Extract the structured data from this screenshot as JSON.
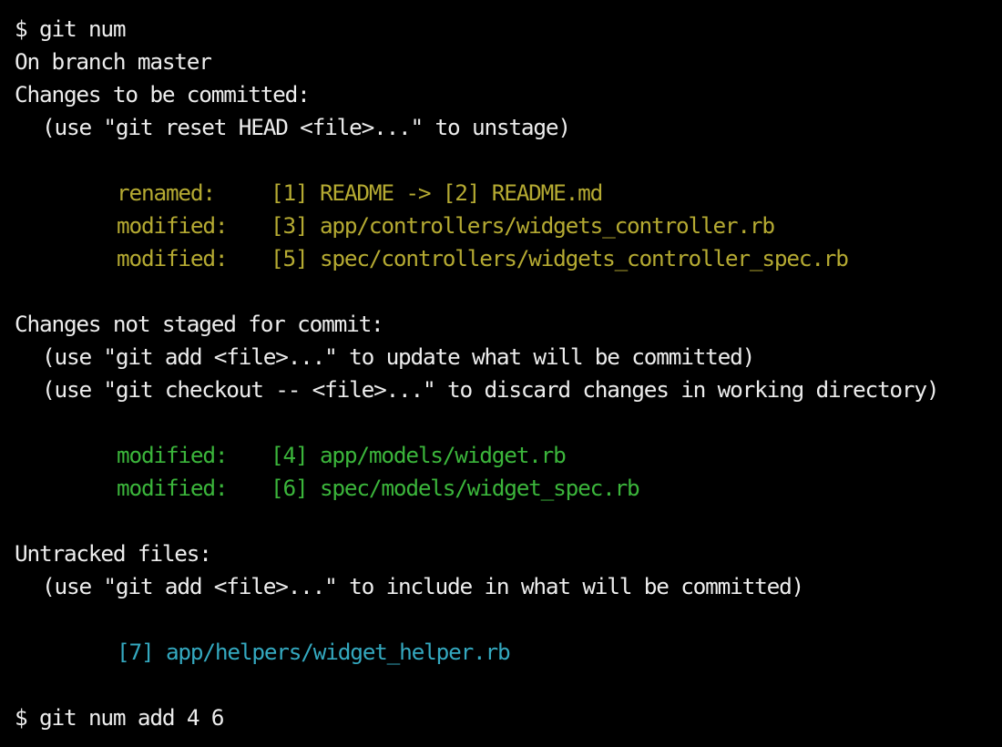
{
  "prompt": "$",
  "command1": "git num",
  "branch_line": "On branch master",
  "staged": {
    "header": "Changes to be committed:",
    "hint": "(use \"git reset HEAD <file>...\" to unstage)",
    "files": [
      {
        "status": "renamed:",
        "text": "[1] README -> [2] README.md"
      },
      {
        "status": "modified:",
        "text": "[3] app/controllers/widgets_controller.rb"
      },
      {
        "status": "modified:",
        "text": "[5] spec/controllers/widgets_controller_spec.rb"
      }
    ],
    "color": "#b5aa32"
  },
  "unstaged": {
    "header": "Changes not staged for commit:",
    "hints": [
      "(use \"git add <file>...\" to update what will be committed)",
      "(use \"git checkout -- <file>...\" to discard changes in working directory)"
    ],
    "files": [
      {
        "status": "modified:",
        "text": "[4] app/models/widget.rb"
      },
      {
        "status": "modified:",
        "text": "[6] spec/models/widget_spec.rb"
      }
    ],
    "color": "#3bb53b"
  },
  "untracked": {
    "header": "Untracked files:",
    "hint": "(use \"git add <file>...\" to include in what will be committed)",
    "files": [
      {
        "text": "[7] app/helpers/widget_helper.rb"
      }
    ],
    "color": "#34a9c0"
  },
  "command2": "git num add 4 6"
}
